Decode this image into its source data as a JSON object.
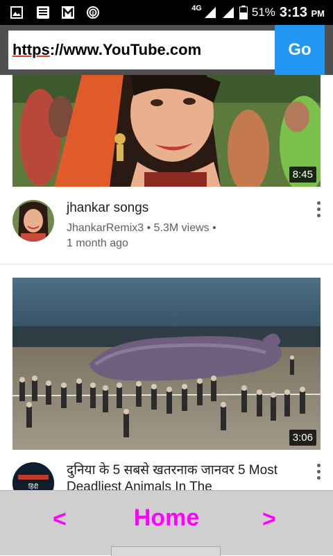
{
  "status_bar": {
    "network_type": "4G",
    "battery_percent": "51%",
    "time": "3:13",
    "ampm": "PM",
    "icons": [
      "gallery-icon",
      "news-icon",
      "gmail-icon",
      "hotspot-icon",
      "signal-icon",
      "battery-icon"
    ]
  },
  "url_bar": {
    "scheme": "https",
    "rest": "://www.YouTube.com",
    "go_label": "Go"
  },
  "videos": [
    {
      "title": "jhankar songs",
      "meta_line1": "JhankarRemix3 • 5.3M views •",
      "meta_line2": "1 month ago",
      "duration": "8:45"
    },
    {
      "title": "दुनिया के 5 सबसे खतरनाक जानवर 5 Most Deadliest Animals In The",
      "duration": "3:06",
      "channel_badge": "हिंदी"
    }
  ],
  "bottom_nav": {
    "back_label": "<",
    "home_label": "Home",
    "forward_label": ">"
  },
  "colors": {
    "status_bar": "#000000",
    "url_bar_bg": "#4f4f4f",
    "go_button": "#2196f3",
    "nav_text": "#ff00ff",
    "nav_bg": "#cfcfcf"
  }
}
